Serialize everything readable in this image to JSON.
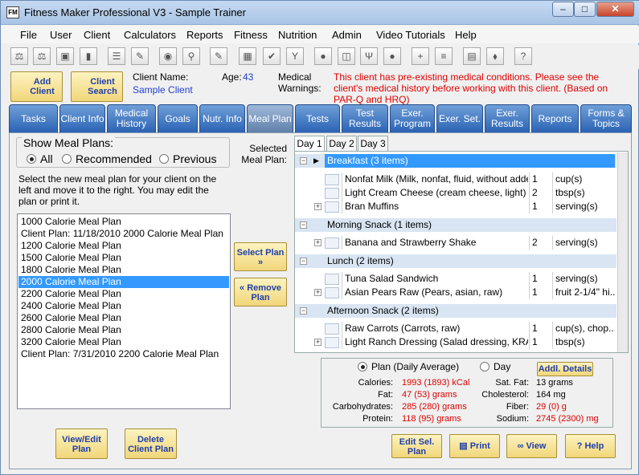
{
  "window": {
    "title": "Fitness Maker Professional V3 - Sample Trainer",
    "app_icon": "FM",
    "min": "–",
    "max": "□",
    "close": "✕"
  },
  "menu": [
    "File",
    "User",
    "Client",
    "Calculators",
    "Reports",
    "Fitness",
    "Nutrition",
    "Admin",
    "Video Tutorials",
    "Help"
  ],
  "toolbar_icons": [
    "weights-icon",
    "weights-icon",
    "save-icon",
    "book-icon",
    "list-icon",
    "clipboard-icon",
    "users-icon",
    "search-icon",
    "notepad-icon",
    "checkers-icon",
    "checklist-icon",
    "glass-icon",
    "apple-icon",
    "bottle-icon",
    "fork-icon",
    "pepper-icon",
    "plus-icon",
    "document-icon",
    "clipboard-icon",
    "eraser-icon",
    "help-icon"
  ],
  "toolbar_glyphs": [
    "⚖",
    "⚖",
    "▣",
    "▮",
    "☰",
    "✎",
    "◉",
    "⚲",
    "✎",
    "▦",
    "✔",
    "Y",
    "●",
    "◫",
    "Ψ",
    "●",
    "+",
    "≡",
    "▤",
    "⬧",
    "?"
  ],
  "actions": {
    "add_client": "Add Client",
    "client_search": "Client Search"
  },
  "client": {
    "name_label": "Client Name:",
    "name": "Sample Client",
    "age_label": "Age:",
    "age": "43"
  },
  "warnings": {
    "label": "Medical Warnings:",
    "text": "This client has pre-existing medical conditions. Please see the client's medical history before working with this client. (Based on PAR-Q and HRQ)"
  },
  "tabs": [
    "Tasks",
    "Client Info",
    "Medical History",
    "Goals",
    "Nutr. Info",
    "Meal Plan",
    "Tests",
    "Test Results",
    "Exer. Program",
    "Exer. Set.",
    "Exer. Results",
    "Reports",
    "Forms & Topics"
  ],
  "active_tab": "Meal Plan",
  "show_plans": {
    "legend": "Show Meal Plans:",
    "options": [
      "All",
      "Recommended",
      "Previous"
    ],
    "selected": "All"
  },
  "instructions": "Select the new meal plan for your client on the left and move it to the right. You may edit the plan or print it.",
  "meal_plans": [
    "1000 Calorie Meal Plan",
    "Client Plan: 11/18/2010 2000 Calorie Meal Plan",
    "1200 Calorie Meal Plan",
    "1500 Calorie Meal Plan",
    "1800 Calorie Meal Plan",
    "2000 Calorie Meal Plan",
    "2200 Calorie Meal Plan",
    "2400 Calorie Meal Plan",
    "2600 Calorie Meal Plan",
    "2800 Calorie Meal Plan",
    "3200 Calorie Meal Plan",
    "Client Plan: 7/31/2010 2200 Calorie Meal Plan"
  ],
  "selected_plan": "2000 Calorie Meal Plan",
  "buttons": {
    "select_plan": "Select Plan",
    "remove_plan": "Remove Plan",
    "view_edit_plan": "View/Edit Plan",
    "delete_client_plan": "Delete Client Plan",
    "edit_sel_plan": "Edit Sel. Plan",
    "print": "Print",
    "view": "View",
    "help": "Help",
    "addl_details": "Addl. Details"
  },
  "selected_meal_plan_label": "Selected Meal Plan:",
  "days": [
    "Day 1",
    "Day 2",
    "Day 3"
  ],
  "active_day": "Day 1",
  "meals": [
    {
      "header": "Breakfast (3 items)",
      "selected": true,
      "items": [
        {
          "food": "Nonfat Milk (Milk, nonfat, fluid, without adde...",
          "qty": "1",
          "unit": "cup(s)"
        },
        {
          "food": "Light Cream Cheese (cream cheese, light)",
          "qty": "2",
          "unit": "tbsp(s)"
        },
        {
          "food": "Bran Muffins",
          "qty": "1",
          "unit": "serving(s)"
        }
      ]
    },
    {
      "header": "Morning Snack (1 items)",
      "items": [
        {
          "food": "Banana and Strawberry Shake",
          "qty": "2",
          "unit": "serving(s)"
        }
      ]
    },
    {
      "header": "Lunch (2 items)",
      "items": [
        {
          "food": "Tuna Salad Sandwich",
          "qty": "1",
          "unit": "serving(s)"
        },
        {
          "food": "Asian Pears Raw (Pears, asian, raw)",
          "qty": "1",
          "unit": "fruit 2-1/4\" hi..."
        }
      ]
    },
    {
      "header": "Afternoon Snack (2 items)",
      "items": [
        {
          "food": "Raw Carrots (Carrots, raw)",
          "qty": "1",
          "unit": "cup(s), chop..."
        },
        {
          "food": "Light Ranch Dressing (Salad dressing, KRA...",
          "qty": "1",
          "unit": "tbsp(s)"
        }
      ]
    }
  ],
  "nutrition": {
    "mode_options": [
      "Plan (Daily Average)",
      "Day"
    ],
    "mode_selected": "Plan (Daily Average)",
    "left": [
      {
        "label": "Calories:",
        "value": "1993 (1893) kCal"
      },
      {
        "label": "Fat:",
        "value": "47 (53) grams"
      },
      {
        "label": "Carbohydrates:",
        "value": "285 (280) grams"
      },
      {
        "label": "Protein:",
        "value": "118 (95) grams"
      }
    ],
    "right": [
      {
        "label": "Sat. Fat:",
        "value": "13 grams",
        "warn": false
      },
      {
        "label": "Cholesterol:",
        "value": "164 mg",
        "warn": false
      },
      {
        "label": "Fiber:",
        "value": "29 (0) g",
        "warn": true
      },
      {
        "label": "Sodium:",
        "value": "2745 (2300) mg",
        "warn": true
      }
    ]
  },
  "colors": {
    "tab_blue": "#2b63b4",
    "selection": "#3399ff",
    "warning_red": "#e00000",
    "link_blue": "#1f3fd0",
    "button_gold": "#f1d67a"
  }
}
